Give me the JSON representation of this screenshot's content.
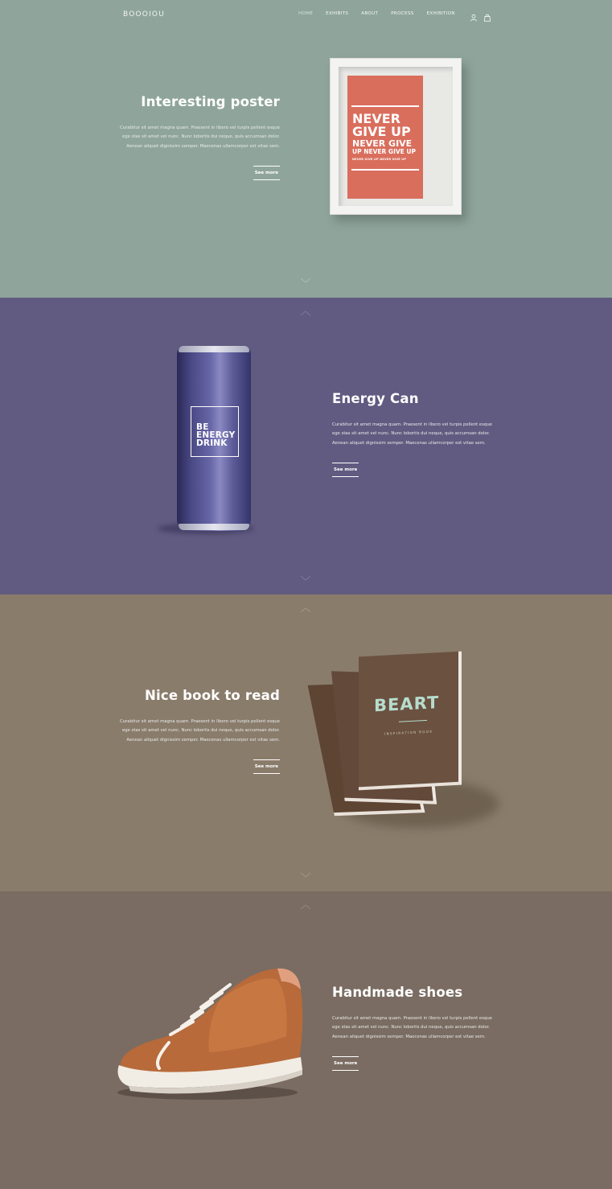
{
  "header": {
    "logo": "BOOOIOU",
    "nav": [
      "HOME",
      "EXHIBITS",
      "ABOUT",
      "PROCESS",
      "EXHIBITION"
    ],
    "icons": [
      "user-icon",
      "bag-icon"
    ]
  },
  "sections": [
    {
      "title": "Interesting poster",
      "body": "Curabitur sit amet magna quam. Praesent in libero vel turpis pellent esque ege stas sit amet vel nunc. Nunc lobortis dui neque, quis accumsan dolor. Aenean aliquet dignissim semper. Maecenas ullamcorper est vitae sem.",
      "link": "See more",
      "background": "#8fa59c",
      "product": {
        "line1": "NEVER",
        "line2": "GIVE UP",
        "line3": "NEVER GIVE",
        "line4": "UP NEVER GIVE UP",
        "line5": "NEVER GIVE UP NEVER GIVE UP"
      }
    },
    {
      "title": "Energy Can",
      "body": "Curabitur sit amet magna quam. Praesent in libero vel turpis pellent esque ege stas sit amet vel nunc. Nunc lobortis dui neque, quis accumsan dolor. Aenean aliquet dignissim semper. Maecenas ullamcorper est vitae sem.",
      "link": "See more",
      "background": "#615b81",
      "product": {
        "line1": "BE",
        "line2": "ENERGY",
        "line3": "DRINK"
      }
    },
    {
      "title": "Nice book to read",
      "body": "Curabitur sit amet magna quam. Praesent in libero vel turpis pellent esque ege stas sit amet vel nunc. Nunc lobortis dui neque, quis accumsan dolor. Aenean aliquet dignissim semper. Maecenas ullamcorper est vitae sem.",
      "link": "See more",
      "background": "#8a7c6b",
      "product": {
        "title": "BEART",
        "subtitle": "INSPIRATION BOOK"
      }
    },
    {
      "title": "Handmade shoes",
      "body": "Curabitur sit amet magna quam. Praesent in libero vel turpis pellent esque ege stas sit amet vel nunc. Nunc lobortis dui neque, quis accumsan dolor. Aenean aliquet dignissim semper. Maecenas ullamcorper est vitae sem.",
      "link": "See more",
      "background": "#7a6c62"
    }
  ]
}
